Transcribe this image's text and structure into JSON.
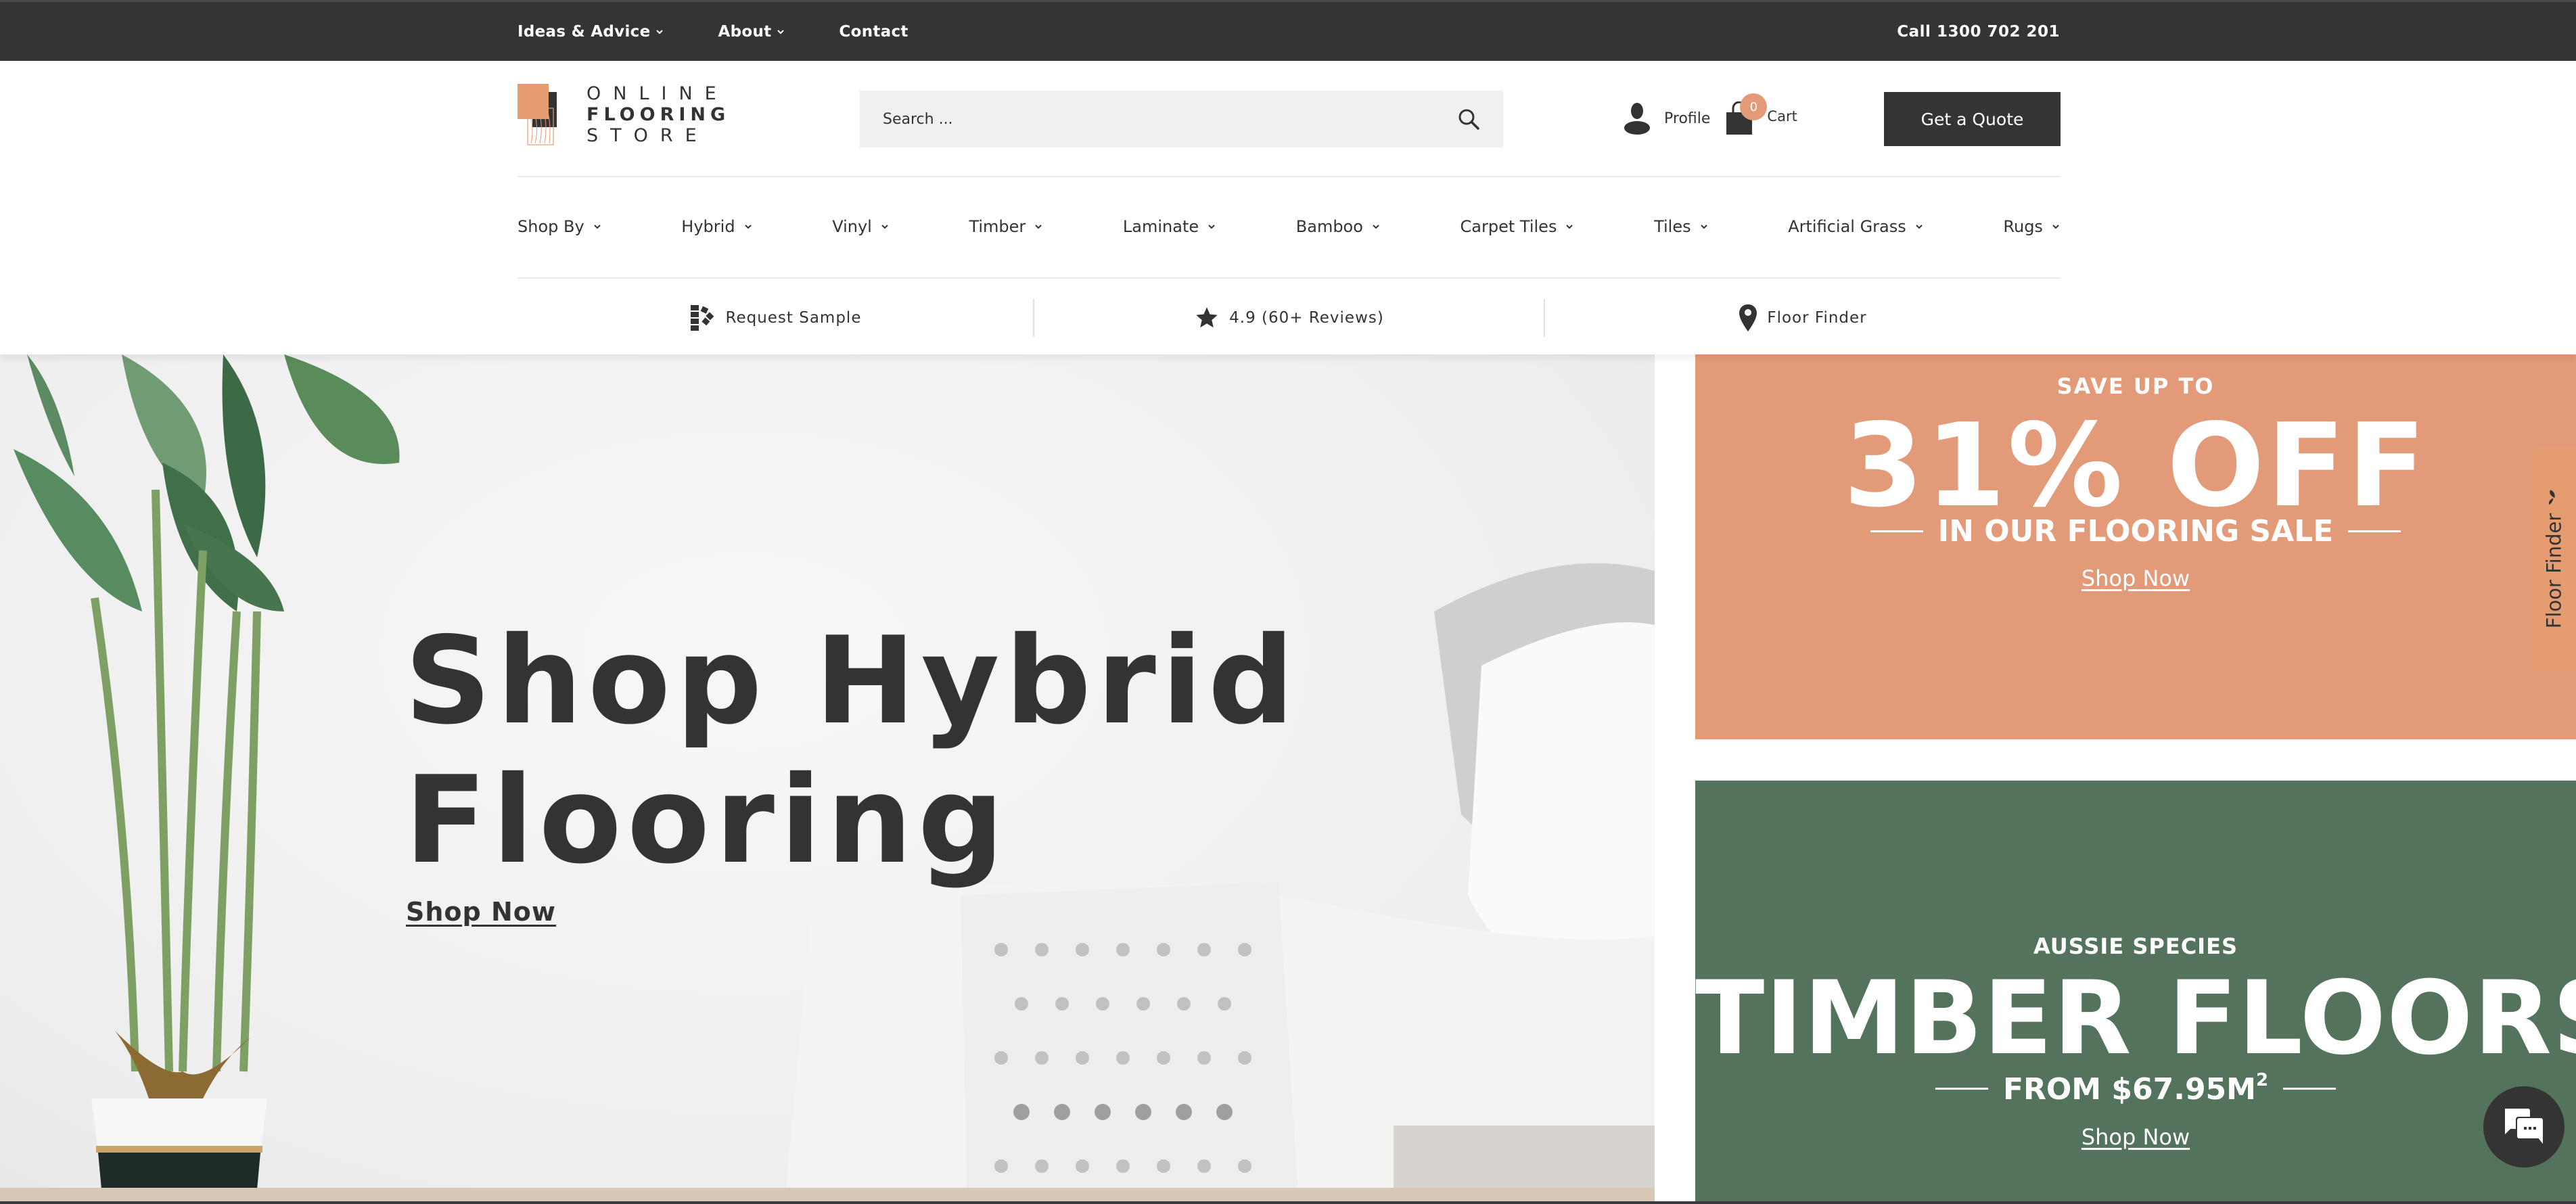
{
  "topbar": {
    "links": [
      {
        "label": "Ideas & Advice",
        "has_dropdown": true
      },
      {
        "label": "About",
        "has_dropdown": true
      },
      {
        "label": "Contact",
        "has_dropdown": false
      }
    ],
    "phone": "Call 1300 702 201"
  },
  "header": {
    "logo": {
      "line1": "ONLINE",
      "line2": "FLOORING",
      "line3": "STORE"
    },
    "search": {
      "placeholder": "Search ...",
      "value": "",
      "icon": "search-icon"
    },
    "profile_label": "Profile",
    "cart_label": "Cart",
    "cart_count": "0",
    "quote_button": "Get a Quote"
  },
  "nav": {
    "items": [
      {
        "label": "Shop By"
      },
      {
        "label": "Hybrid"
      },
      {
        "label": "Vinyl"
      },
      {
        "label": "Timber"
      },
      {
        "label": "Laminate"
      },
      {
        "label": "Bamboo"
      },
      {
        "label": "Carpet Tiles"
      },
      {
        "label": "Tiles"
      },
      {
        "label": "Artificial Grass"
      },
      {
        "label": "Rugs"
      }
    ]
  },
  "subbar": {
    "request_sample": {
      "label": "Request Sample",
      "icon": "swatch-fan-icon"
    },
    "reviews": {
      "label": "4.9 (60+ Reviews)",
      "rating": 4.9,
      "icon": "star-icon"
    },
    "floor_finder": {
      "label": "Floor Finder",
      "icon": "map-pin-icon"
    }
  },
  "hero": {
    "title_line1": "Shop Hybrid",
    "title_line2": "Flooring",
    "cta": "Shop Now"
  },
  "promo_sale": {
    "kicker": "SAVE UP TO",
    "headline": "31% OFF",
    "subline": "IN OUR FLOORING SALE",
    "cta": "Shop Now"
  },
  "promo_timber": {
    "kicker": "AUSSIE SPECIES",
    "headline": "TIMBER FLOORS",
    "subline": "FROM $67.95M",
    "subline_sup": "2",
    "cta": "Shop Now"
  },
  "floor_finder_tab": {
    "label": "Floor Finder"
  },
  "chat": {
    "icon": "chat-bubbles-icon"
  },
  "colors": {
    "dark": "#343434",
    "accent_orange": "#e39a78",
    "accent_green": "#53735c",
    "search_bg": "#f0f0f0"
  }
}
